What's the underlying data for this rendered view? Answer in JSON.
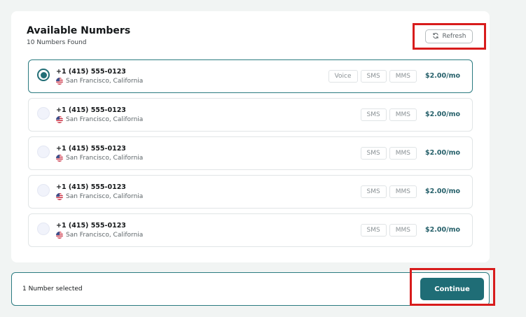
{
  "header": {
    "title": "Available Numbers",
    "subtitle": "10 Numbers Found",
    "refresh_label": "Refresh"
  },
  "numbers": [
    {
      "phone": "+1 (415) 555-0123",
      "location": "San Francisco, California",
      "capabilities": [
        "Voice",
        "SMS",
        "MMS"
      ],
      "price": "$2.00/mo",
      "selected": true
    },
    {
      "phone": "+1 (415) 555-0123",
      "location": "San Francisco, California",
      "capabilities": [
        "SMS",
        "MMS"
      ],
      "price": "$2.00/mo",
      "selected": false
    },
    {
      "phone": "+1 (415) 555-0123",
      "location": "San Francisco, California",
      "capabilities": [
        "SMS",
        "MMS"
      ],
      "price": "$2.00/mo",
      "selected": false
    },
    {
      "phone": "+1 (415) 555-0123",
      "location": "San Francisco, California",
      "capabilities": [
        "SMS",
        "MMS"
      ],
      "price": "$2.00/mo",
      "selected": false
    },
    {
      "phone": "+1 (415) 555-0123",
      "location": "San Francisco, California",
      "capabilities": [
        "SMS",
        "MMS"
      ],
      "price": "$2.00/mo",
      "selected": false
    }
  ],
  "footer": {
    "selection_text": "1 Number selected",
    "continue_label": "Continue"
  },
  "icons": {
    "refresh": "refresh-icon",
    "flag": "us-flag-icon"
  },
  "colors": {
    "accent": "#1f6d76",
    "price": "#26606a",
    "highlight": "#d81c1c",
    "background": "#f1f4f3"
  }
}
